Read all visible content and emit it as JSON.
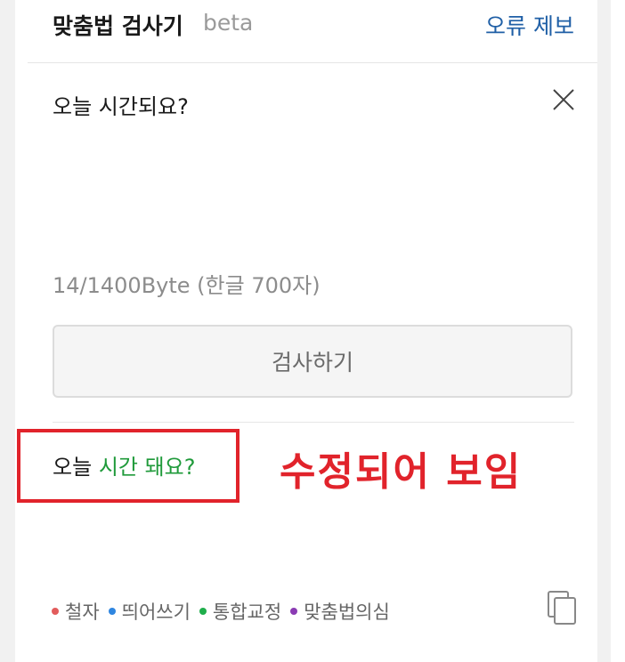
{
  "header": {
    "title": "맞춤법 검사기",
    "beta": "beta",
    "report_label": "오류 제보"
  },
  "editor": {
    "input_text": "오늘 시간되요?",
    "close_icon": "close-icon",
    "byte_counter": "14/1400Byte (한글 700자)"
  },
  "check_button": {
    "label": "검사하기"
  },
  "result": {
    "prefix": "오늘",
    "corrected": "시간 돼요?"
  },
  "legend": [
    {
      "label": "철자",
      "color": "#e25c5c"
    },
    {
      "label": "띄어쓰기",
      "color": "#2f86e0"
    },
    {
      "label": "통합교정",
      "color": "#1fae4b"
    },
    {
      "label": "맞춤법의심",
      "color": "#8a3bb3"
    }
  ],
  "copy_icon": "copy-icon",
  "annotation": {
    "text": "수정되어 보임",
    "color": "#e1232b"
  }
}
